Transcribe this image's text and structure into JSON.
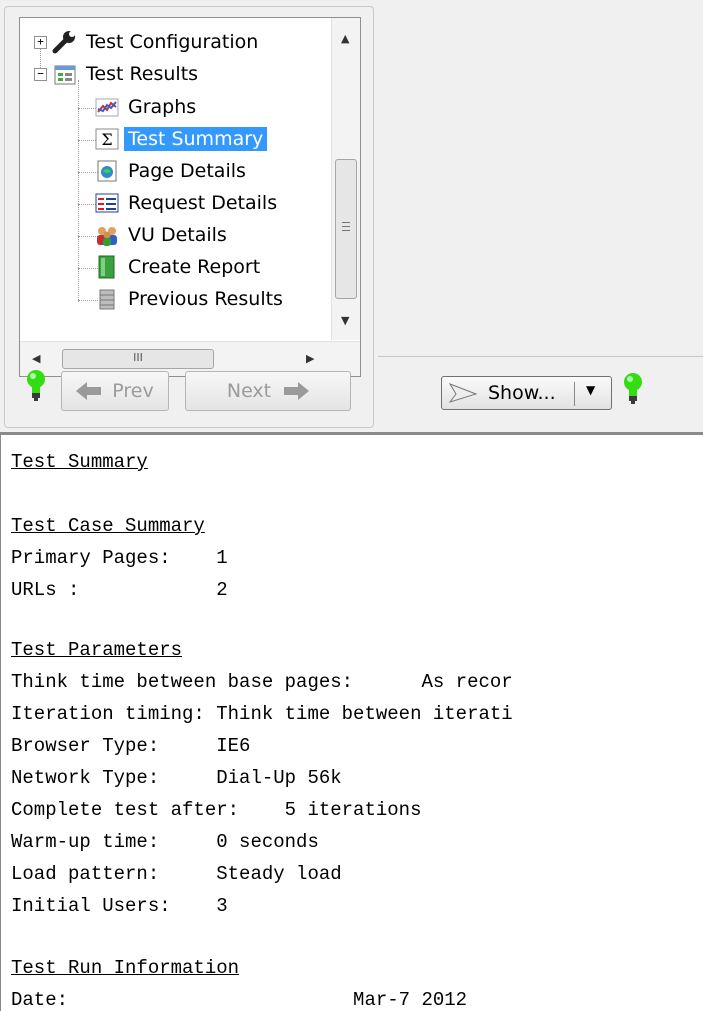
{
  "tree": {
    "items": [
      {
        "label": "Test Configuration",
        "icon": "wrench-icon",
        "expander": "+"
      },
      {
        "label": "Test Results",
        "icon": "results-icon",
        "expander": "−"
      },
      {
        "label": "Graphs",
        "icon": "graph-icon"
      },
      {
        "label": "Test Summary",
        "icon": "sigma-icon",
        "selected": true
      },
      {
        "label": "Page Details",
        "icon": "page-icon"
      },
      {
        "label": "Request Details",
        "icon": "request-icon"
      },
      {
        "label": "VU Details",
        "icon": "users-icon"
      },
      {
        "label": "Create Report",
        "icon": "report-icon"
      },
      {
        "label": "Previous Results",
        "icon": "database-icon"
      }
    ],
    "hscroll_grip": "III"
  },
  "nav": {
    "prev_label": "Prev",
    "next_label": "Next",
    "show_label": "Show..."
  },
  "colors": {
    "selection": "#3399ff",
    "bulb": "#33dd11"
  },
  "report": {
    "lines": [
      {
        "text": "Test Summary",
        "heading": true
      },
      {
        "text": "",
        "heading": false
      },
      {
        "text": "Test Case Summary",
        "heading": true
      },
      {
        "text": "Primary Pages:    1",
        "heading": false
      },
      {
        "text": "URLs :            2",
        "heading": false
      },
      {
        "text": "",
        "heading": false
      },
      {
        "text": "Test Parameters",
        "heading": true
      },
      {
        "text": "Think time between base pages:      As recor",
        "heading": false
      },
      {
        "text": "Iteration timing: Think time between iterati",
        "heading": false
      },
      {
        "text": "Browser Type:     IE6",
        "heading": false
      },
      {
        "text": "Network Type:     Dial-Up 56k",
        "heading": false
      },
      {
        "text": "Complete test after:    5 iterations",
        "heading": false
      },
      {
        "text": "Warm-up time:     0 seconds",
        "heading": false
      },
      {
        "text": "Load pattern:     Steady load",
        "heading": false
      },
      {
        "text": "Initial Users:    3",
        "heading": false
      },
      {
        "text": "",
        "heading": false
      },
      {
        "text": "Test Run Information",
        "heading": true
      },
      {
        "text": "Date:                         Mar-7 2012",
        "heading": false
      }
    ]
  }
}
